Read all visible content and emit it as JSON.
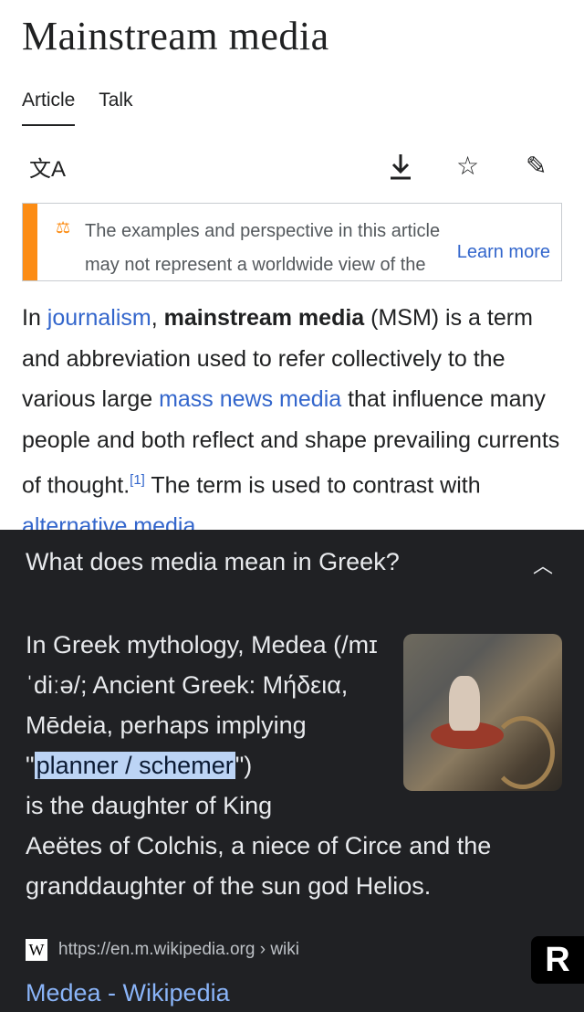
{
  "article": {
    "title": "Mainstream media",
    "tabs": [
      "Article",
      "Talk"
    ],
    "actions": {
      "translate_icon": "translate-icon",
      "download_icon": "download-icon",
      "watch_icon": "star-icon",
      "edit_icon": "pencil-icon"
    }
  },
  "notice": {
    "text": "The examples and perspective in this article may not represent a worldwide view of the",
    "learn_more": "Learn more",
    "accent_color": "#fc8c14"
  },
  "paragraph": {
    "p1": "In ",
    "journalism": "journalism",
    "p2": ", ",
    "term": "mainstream media",
    "p3": " (MSM) is a term and abbreviation used to refer collectively to the various large ",
    "mass_news_media": "mass news media",
    "p4": " that influence many people and both reflect and shape prevailing currents of thought.",
    "ref": "[1]",
    "p5": " The term is used to contrast with ",
    "alternative_media": "alternative media",
    "p6": "."
  },
  "search": {
    "question": "What does media mean in Greek?",
    "answer_pre": "In Greek mythology, Medea (/mɪˈdiːə/; Ancient Greek: Μήδεια, Mēdeia, perhaps implying \"",
    "highlight": "planner / schemer",
    "answer_post": "\") is the daughter of King Aeëtes of Colchis, a niece of Circe and the granddaughter of the sun god Helios.",
    "source_icon": "W",
    "source_url": "https://en.m.wikipedia.org › wiki",
    "result_title": "Medea - Wikipedia"
  },
  "watermark": "R"
}
